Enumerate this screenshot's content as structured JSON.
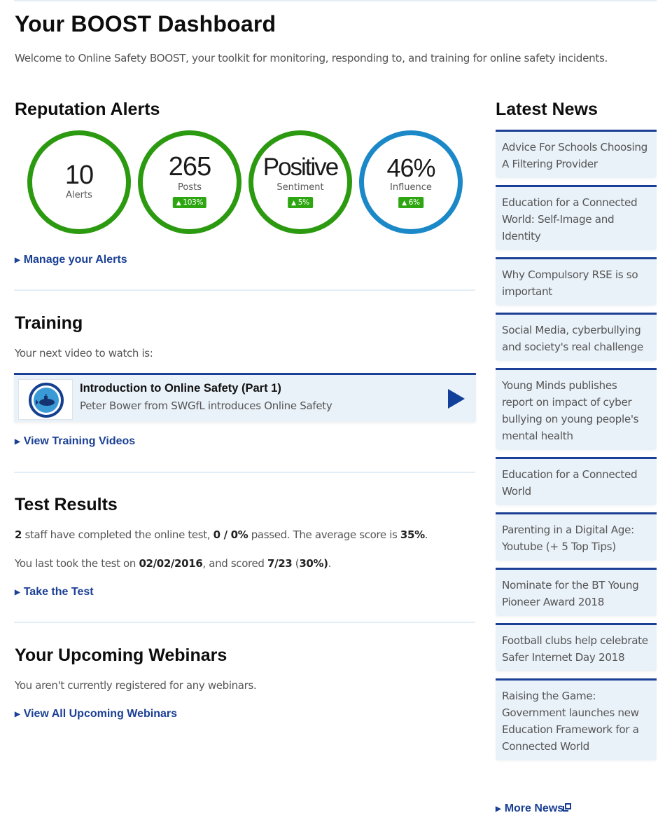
{
  "header": {
    "title": "Your BOOST Dashboard",
    "intro": "Welcome to Online Safety BOOST, your toolkit for monitoring, responding to, and training for online safety incidents."
  },
  "reputation": {
    "title": "Reputation Alerts",
    "metrics": [
      {
        "value": "10",
        "label": "Alerts",
        "change": null,
        "ring_color": "#2c9a10"
      },
      {
        "value": "265",
        "label": "Posts",
        "change": "103%",
        "ring_color": "#2c9a10"
      },
      {
        "value": "Positive",
        "label": "Sentiment",
        "change": "5%",
        "ring_color": "#2c9a10"
      },
      {
        "value": "46%",
        "label": "Influence",
        "change": "6%",
        "ring_color": "#1b88c7"
      }
    ],
    "change_arrow": "▲",
    "link": "Manage your Alerts"
  },
  "training": {
    "title": "Training",
    "intro": "Your next video to watch is:",
    "video": {
      "title": "Introduction to Online Safety (Part 1)",
      "subtitle": "Peter Bower from SWGfL introduces Online Safety"
    },
    "link": "View Training Videos"
  },
  "tests": {
    "title": "Test Results",
    "line1": {
      "staff_count": "2",
      "text_a": " staff have completed the online test, ",
      "passed": "0 / 0%",
      "text_b": " passed. The average score is ",
      "average": "35%",
      "text_c": "."
    },
    "line2": {
      "text_a": "You last took the test on ",
      "date": "02/02/2016",
      "text_b": ", and scored ",
      "score": "7/23",
      "text_c": " (",
      "percent": "30%)",
      "text_d": "."
    },
    "link": "Take the Test"
  },
  "webinars": {
    "title": "Your Upcoming Webinars",
    "message": "You aren't currently registered for any webinars.",
    "link": "View All Upcoming Webinars"
  },
  "news": {
    "title": "Latest News",
    "items": [
      "Advice For Schools Choosing A Filtering Provider",
      "Education for a Connected World: Self-Image and Identity",
      "Why Compulsory RSE is so important",
      "Social Media, cyberbullying and society's real challenge",
      "Young Minds publishes report on impact of cyber bullying on young people's mental health",
      "Education for a Connected World",
      "Parenting in a Digital Age: Youtube (+ 5 Top Tips)",
      "Nominate for the BT Young Pioneer Award 2018",
      "Football clubs help celebrate Safer Internet Day 2018",
      "Raising the Game: Government launches new Education Framework for a Connected World"
    ],
    "more_link": "More News"
  },
  "colors": {
    "brand_blue": "#1a3f94",
    "green": "#2c9a10",
    "influence_blue": "#1b88c7",
    "card_bg": "#eaf2f9"
  }
}
